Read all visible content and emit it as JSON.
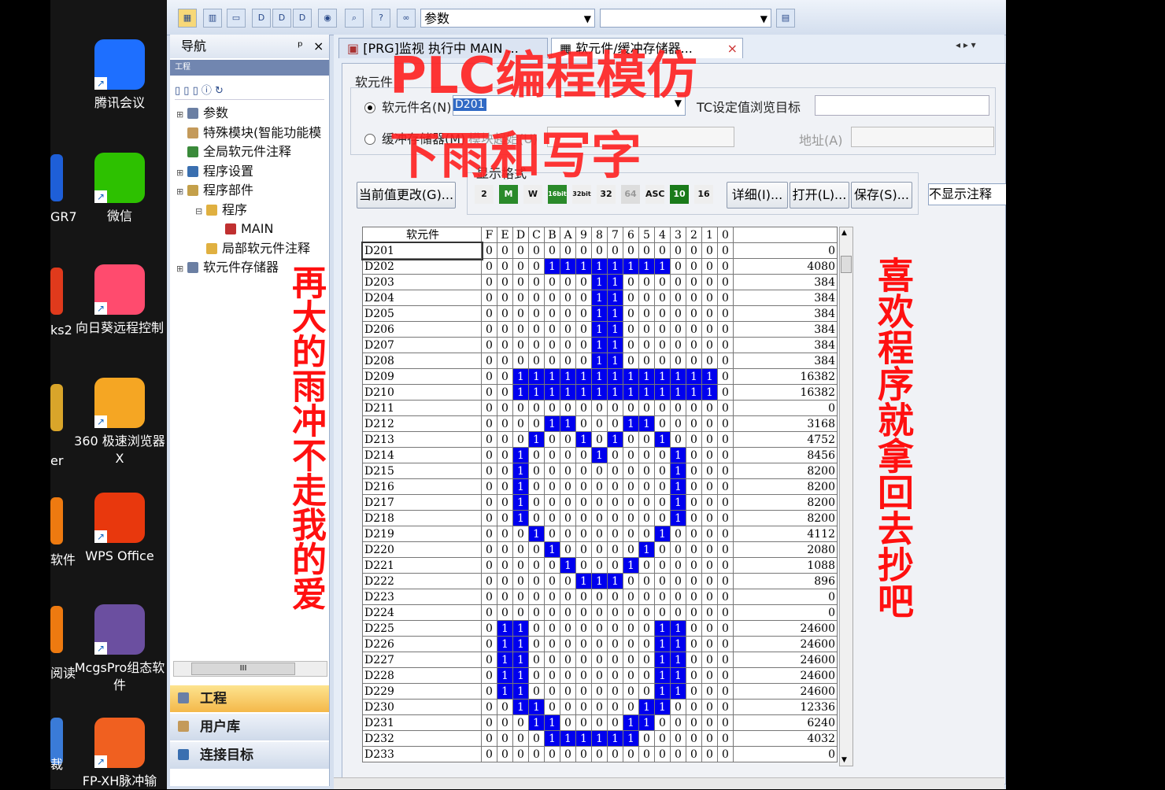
{
  "desktop": {
    "icons": [
      {
        "label": "腾讯会议",
        "color": "#1e6fff"
      },
      {
        "label": "微信",
        "color": "#2dc100"
      },
      {
        "label": "向日葵远程控制",
        "color": "#ff4b6e"
      },
      {
        "label": "360 极速浏览器X",
        "color": "#f5a623"
      },
      {
        "label": "WPS Office",
        "color": "#e8380d"
      },
      {
        "label": "McgsPro组态软件",
        "color": "#6b4fa0"
      },
      {
        "label": "FP-XH脉冲输",
        "color": "#f06020"
      }
    ],
    "cut_labels": [
      "GR7",
      "ks2",
      "er",
      "软件",
      "阅读",
      "裁"
    ]
  },
  "toolbar": {
    "param_combo": "参数"
  },
  "nav": {
    "title": "导航",
    "pin": "ᵖ",
    "close": "×",
    "section": "工程",
    "tree": [
      {
        "label": "参数",
        "indent": 0
      },
      {
        "label": "特殊模块(智能功能模",
        "indent": 0
      },
      {
        "label": "全局软元件注释",
        "indent": 0
      },
      {
        "label": "程序设置",
        "indent": 0
      },
      {
        "label": "程序部件",
        "indent": 0
      },
      {
        "label": "程序",
        "indent": 1
      },
      {
        "label": "MAIN",
        "indent": 2
      },
      {
        "label": "局部软元件注释",
        "indent": 1
      },
      {
        "label": "软元件存储器",
        "indent": 0
      }
    ],
    "panes": [
      "工程",
      "用户库",
      "连接目标"
    ],
    "scroll_thumb": "III"
  },
  "tabs": {
    "tab1": "[PRG]监视 执行中 MAIN ...",
    "tab2": "软元件/缓冲存储器...",
    "close": "×"
  },
  "panel": {
    "group_label": "软元件",
    "radio1": "软元件名(N)",
    "device_value": "D201",
    "target_label": "TC设定值浏览目标",
    "radio2": "缓冲存储器(M)",
    "module_label": "模块起始(U)",
    "addr_label": "地址(A)",
    "format_label": "显示格式",
    "btn_change": "当前值更改(G)...",
    "btn_detail": "详细(I)...",
    "btn_open": "打开(L)...",
    "btn_save": "保存(S)...",
    "comment_combo": "不显示注释",
    "format_buttons": [
      "2",
      "M",
      "W",
      "16bit",
      "32bit",
      "32",
      "64",
      "ASC",
      "10",
      "16"
    ]
  },
  "grid": {
    "header_device": "软元件",
    "bit_headers": [
      "F",
      "E",
      "D",
      "C",
      "B",
      "A",
      "9",
      "8",
      "7",
      "6",
      "5",
      "4",
      "3",
      "2",
      "1",
      "0"
    ],
    "rows": [
      {
        "dev": "D201",
        "bits": "0000000000000000",
        "val": "0"
      },
      {
        "dev": "D202",
        "bits": "0000111111110000",
        "val": "4080"
      },
      {
        "dev": "D203",
        "bits": "0000000110000000",
        "val": "384"
      },
      {
        "dev": "D204",
        "bits": "0000000110000000",
        "val": "384"
      },
      {
        "dev": "D205",
        "bits": "0000000110000000",
        "val": "384"
      },
      {
        "dev": "D206",
        "bits": "0000000110000000",
        "val": "384"
      },
      {
        "dev": "D207",
        "bits": "0000000110000000",
        "val": "384"
      },
      {
        "dev": "D208",
        "bits": "0000000110000000",
        "val": "384"
      },
      {
        "dev": "D209",
        "bits": "0011111111111110",
        "val": "16382"
      },
      {
        "dev": "D210",
        "bits": "0011111111111110",
        "val": "16382"
      },
      {
        "dev": "D211",
        "bits": "0000000000000000",
        "val": "0"
      },
      {
        "dev": "D212",
        "bits": "0000110001100000",
        "val": "3168"
      },
      {
        "dev": "D213",
        "bits": "0001001010010000",
        "val": "4752"
      },
      {
        "dev": "D214",
        "bits": "0010000100001000",
        "val": "8456"
      },
      {
        "dev": "D215",
        "bits": "0010000000001000",
        "val": "8200"
      },
      {
        "dev": "D216",
        "bits": "0010000000001000",
        "val": "8200"
      },
      {
        "dev": "D217",
        "bits": "0010000000001000",
        "val": "8200"
      },
      {
        "dev": "D218",
        "bits": "0010000000001000",
        "val": "8200"
      },
      {
        "dev": "D219",
        "bits": "0001000000010000",
        "val": "4112"
      },
      {
        "dev": "D220",
        "bits": "0000100000100000",
        "val": "2080"
      },
      {
        "dev": "D221",
        "bits": "0000010001000000",
        "val": "1088"
      },
      {
        "dev": "D222",
        "bits": "0000001110000000",
        "val": "896"
      },
      {
        "dev": "D223",
        "bits": "0000000000000000",
        "val": "0"
      },
      {
        "dev": "D224",
        "bits": "0000000000000000",
        "val": "0"
      },
      {
        "dev": "D225",
        "bits": "0110000000011000",
        "val": "24600"
      },
      {
        "dev": "D226",
        "bits": "0110000000011000",
        "val": "24600"
      },
      {
        "dev": "D227",
        "bits": "0110000000011000",
        "val": "24600"
      },
      {
        "dev": "D228",
        "bits": "0110000000011000",
        "val": "24600"
      },
      {
        "dev": "D229",
        "bits": "0110000000011000",
        "val": "24600"
      },
      {
        "dev": "D230",
        "bits": "0011000000110000",
        "val": "12336"
      },
      {
        "dev": "D231",
        "bits": "0001100001100000",
        "val": "6240"
      },
      {
        "dev": "D232",
        "bits": "0000111111000000",
        "val": "4032"
      },
      {
        "dev": "D233",
        "bits": "0000000000000000",
        "val": "0"
      }
    ]
  },
  "overlay": {
    "title1": "PLC编程模仿",
    "title2": "下雨和写字",
    "left_vertical": "再大的雨冲不走我的爱",
    "right_vertical": "喜欢程序就拿回去抄吧",
    "color": "#ff1a1a"
  }
}
